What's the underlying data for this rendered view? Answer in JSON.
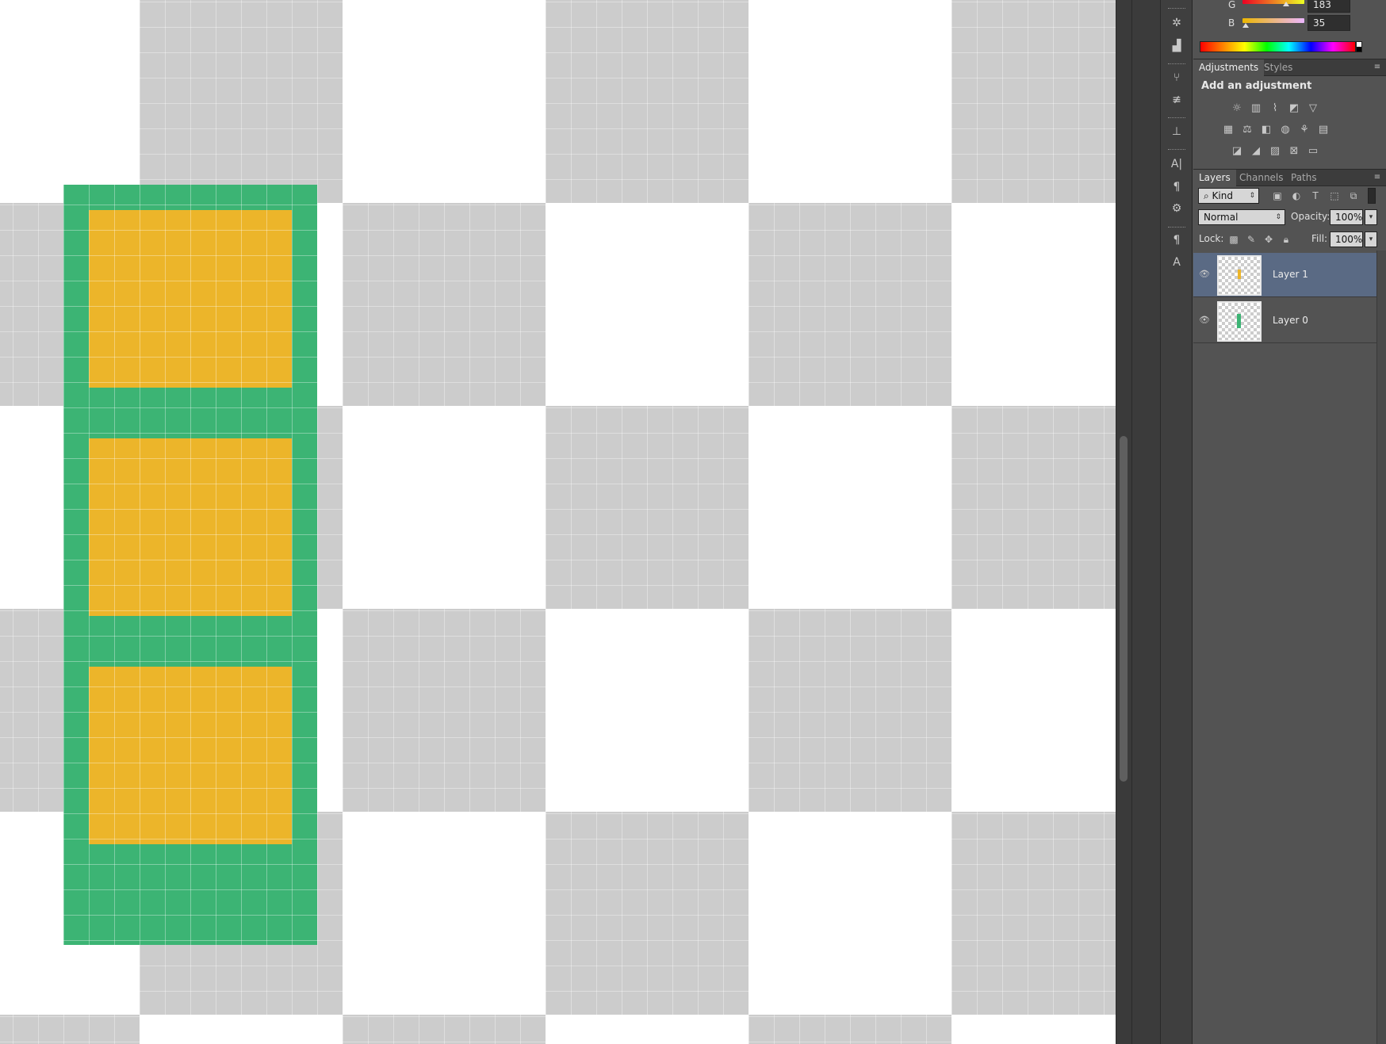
{
  "color": {
    "g_label": "G",
    "g_value": "183",
    "b_label": "B",
    "b_value": "35"
  },
  "panel_tabs_top": {
    "adjustments": "Adjustments",
    "styles": "Styles"
  },
  "adjustments": {
    "title": "Add an adjustment"
  },
  "panel_tabs_layers": {
    "layers": "Layers",
    "channels": "Channels",
    "paths": "Paths"
  },
  "layers": {
    "filter_kind": "Kind",
    "blend_mode": "Normal",
    "opacity_label": "Opacity:",
    "opacity_value": "100%",
    "lock_label": "Lock:",
    "fill_label": "Fill:",
    "fill_value": "100%",
    "items": [
      {
        "name": "Layer 1",
        "selected": true,
        "thumb_color": "#ecb52a"
      },
      {
        "name": "Layer 0",
        "selected": false,
        "thumb_color": "#3cb474"
      }
    ]
  },
  "canvas_colors": {
    "green": "#3cb474",
    "yellow": "#ecb52a"
  }
}
